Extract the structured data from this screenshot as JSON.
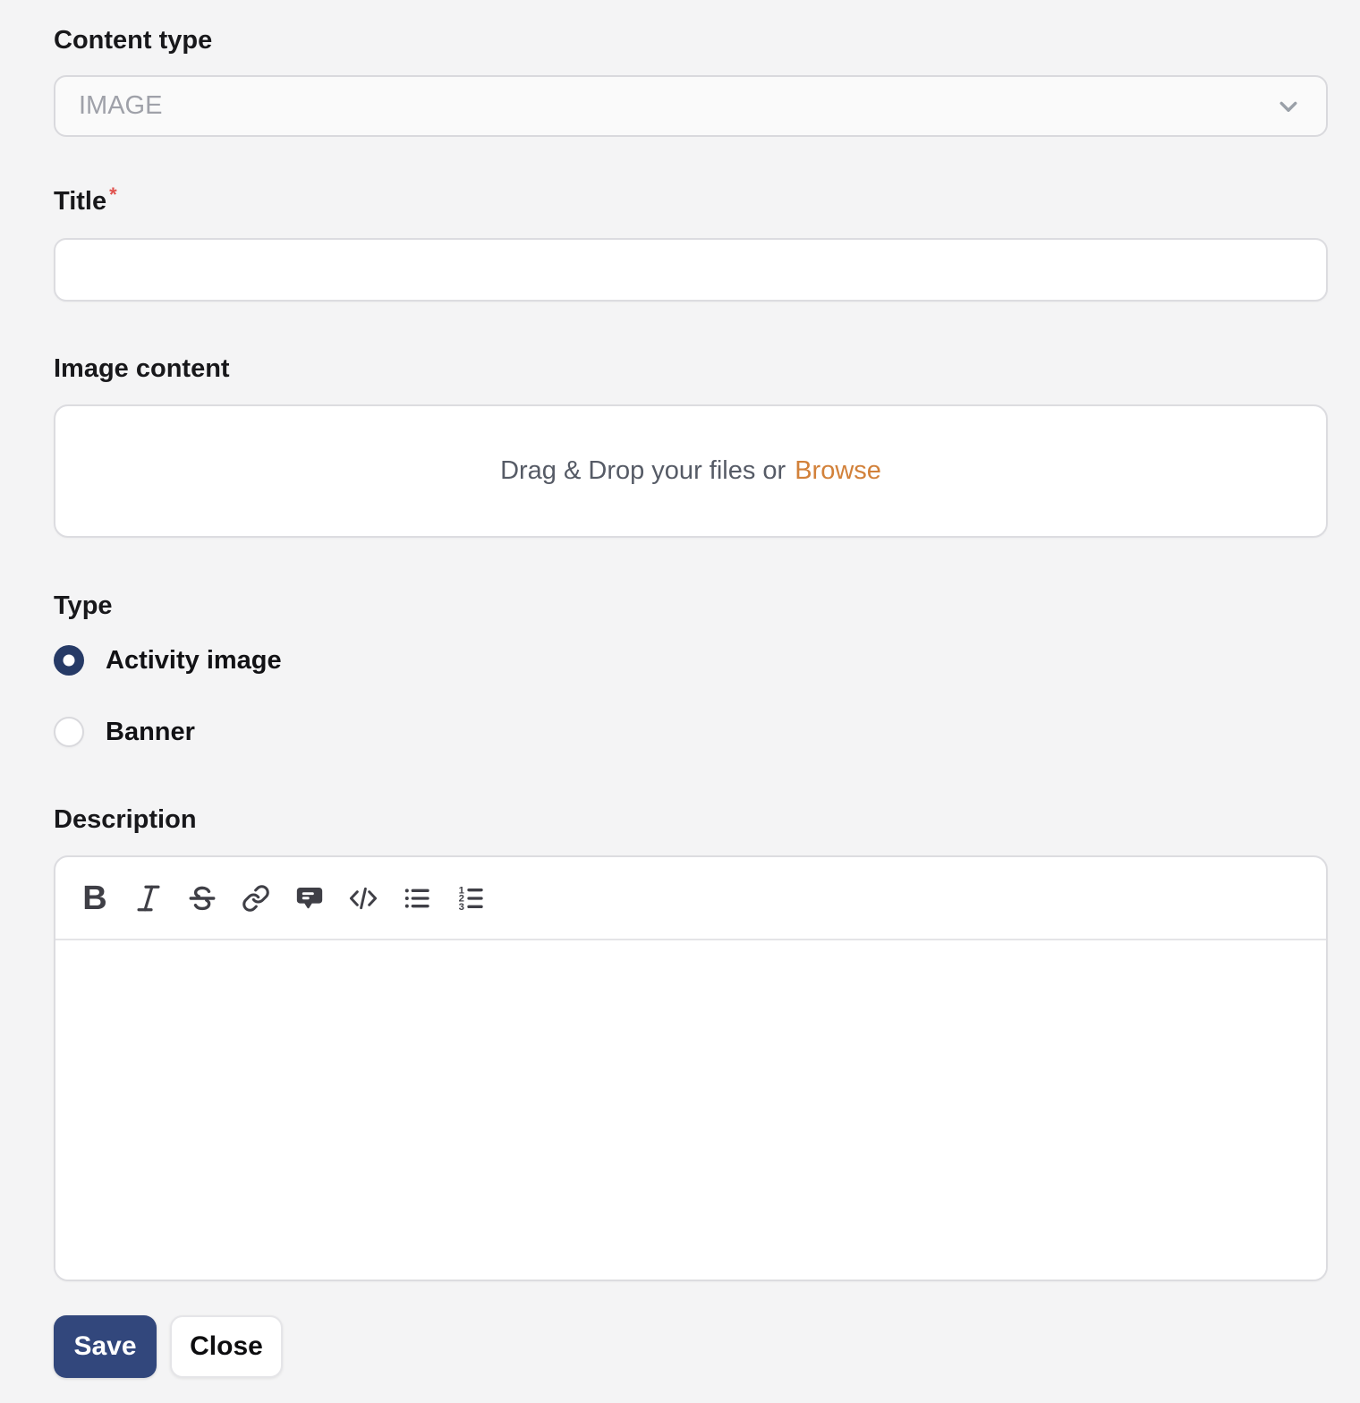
{
  "form": {
    "content_type": {
      "label": "Content type",
      "value": "IMAGE"
    },
    "title": {
      "label": "Title",
      "required_marker": "*",
      "value": ""
    },
    "image_content": {
      "label": "Image content",
      "dropzone_text": "Drag & Drop your files or",
      "browse_label": "Browse"
    },
    "type_group": {
      "label": "Type",
      "options": [
        {
          "label": "Activity image",
          "selected": true
        },
        {
          "label": "Banner",
          "selected": false
        }
      ]
    },
    "description": {
      "label": "Description",
      "value": "",
      "toolbar_tools": [
        "bold",
        "italic",
        "strikethrough",
        "link",
        "comment",
        "code-block",
        "bullet-list",
        "ordered-list"
      ]
    },
    "actions": {
      "save_label": "Save",
      "close_label": "Close"
    }
  },
  "colors": {
    "page_background": "#f4f4f5",
    "accent_navy": "#32477c",
    "radio_selected": "#263a66",
    "browse_orange": "#d2813a",
    "required_red": "#e0524e",
    "border": "#dcdce0"
  }
}
